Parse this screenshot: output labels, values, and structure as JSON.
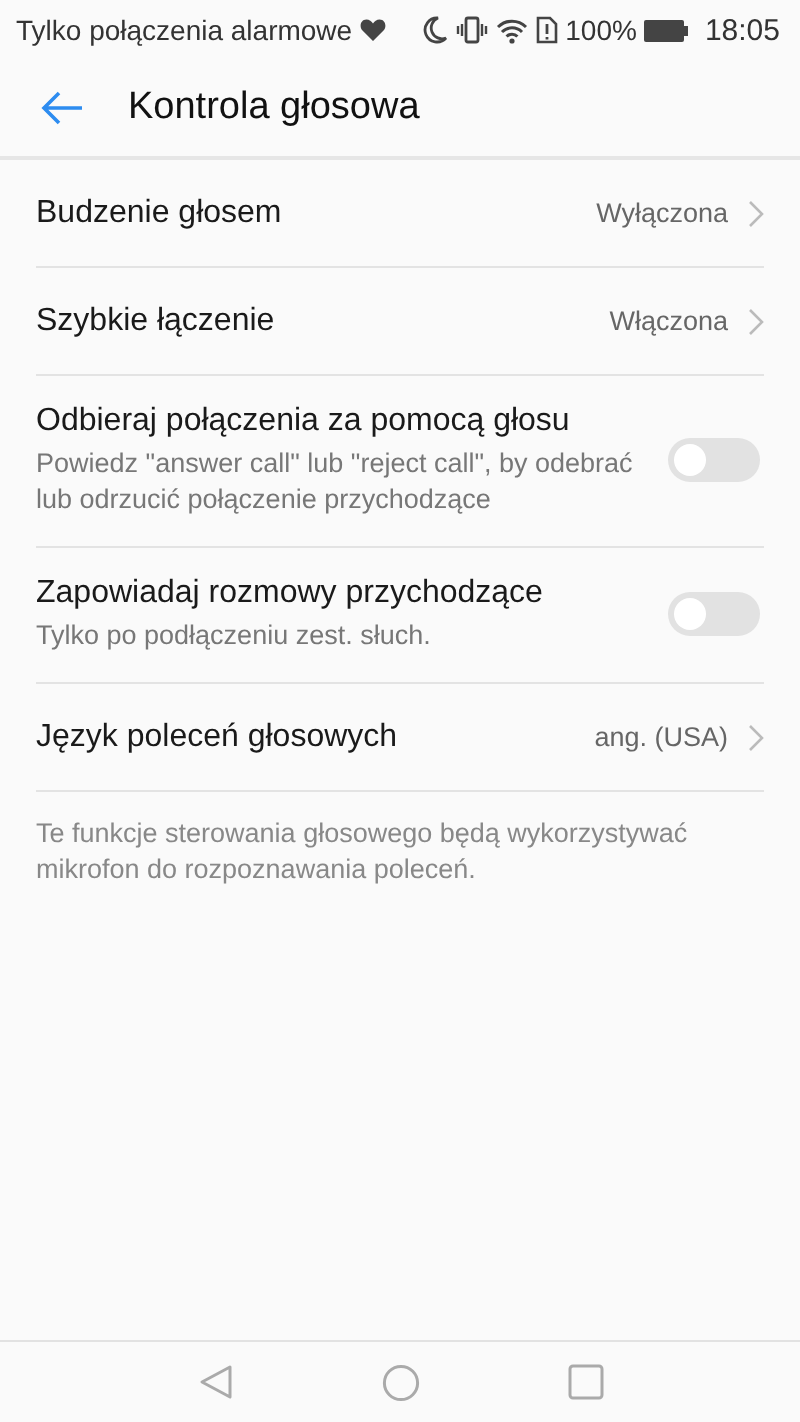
{
  "status_bar": {
    "carrier": "Tylko połączenia alarmowe",
    "battery_text": "100%",
    "time": "18:05"
  },
  "header": {
    "title": "Kontrola głosowa"
  },
  "items": [
    {
      "kind": "link",
      "label": "Budzenie głosem",
      "value": "Wyłączona"
    },
    {
      "kind": "link",
      "label": "Szybkie łączenie",
      "value": "Włączona"
    },
    {
      "kind": "toggle",
      "label": "Odbieraj połączenia za pomocą głosu",
      "description": "Powiedz \"answer call\" lub \"reject call\", by odebrać lub odrzucić połączenie przychodzące",
      "on": false
    },
    {
      "kind": "toggle",
      "label": "Zapowiadaj rozmowy przychodzące",
      "description": "Tylko po podłączeniu zest. słuch.",
      "on": false
    },
    {
      "kind": "link",
      "label": "Język poleceń głosowych",
      "value": "ang. (USA)"
    }
  ],
  "footnote": "Te funkcje sterowania głosowego będą wykorzystywać mikrofon do rozpoznawania poleceń."
}
